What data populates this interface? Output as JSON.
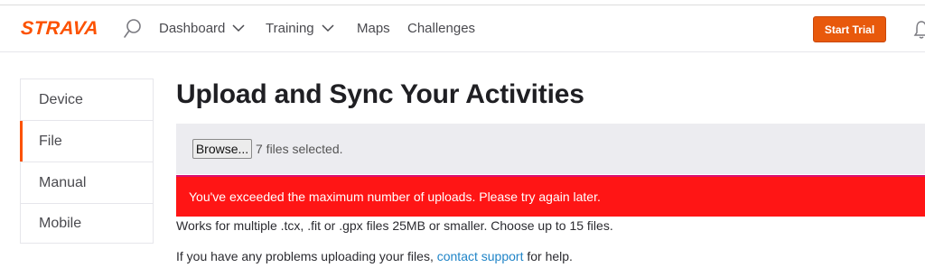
{
  "header": {
    "logo": "STRAVA",
    "nav": [
      {
        "label": "Dashboard",
        "has_dropdown": true
      },
      {
        "label": "Training",
        "has_dropdown": true
      },
      {
        "label": "Maps",
        "has_dropdown": false
      },
      {
        "label": "Challenges",
        "has_dropdown": false
      }
    ],
    "start_trial_label": "Start Trial",
    "icons": {
      "search": "search-icon",
      "dropdown": "chevron-down-icon",
      "notifications": "bell-icon"
    }
  },
  "sidebar": {
    "items": [
      {
        "label": "Device",
        "active": false
      },
      {
        "label": "File",
        "active": true
      },
      {
        "label": "Manual",
        "active": false
      },
      {
        "label": "Mobile",
        "active": false
      }
    ]
  },
  "main": {
    "title": "Upload and Sync Your Activities",
    "upload": {
      "browse_label": "Browse...",
      "files_selected": "7 files selected."
    },
    "error_message": "You've exceeded the maximum number of uploads. Please try again later.",
    "info_line": "Works for multiple .tcx, .fit or .gpx files 25MB or smaller. Choose up to 15 files.",
    "help": {
      "prefix": "If you have any problems uploading your files, ",
      "link": "contact support",
      "suffix": " for help."
    }
  },
  "colors": {
    "brand": "#fc5200",
    "start_trial": "#e8590c",
    "error": "#ff1515",
    "link": "#1f84c7"
  }
}
